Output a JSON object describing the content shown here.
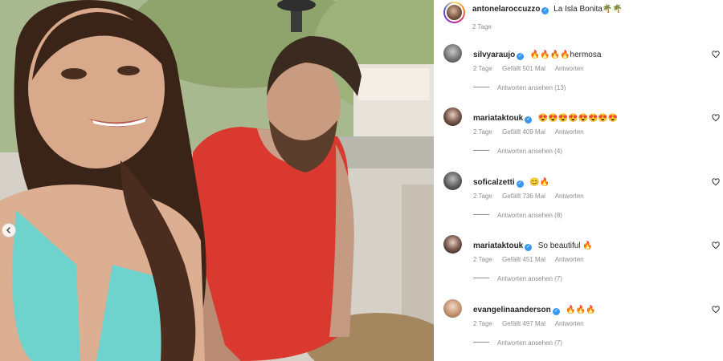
{
  "post": {
    "caption_user": "antonelaroccuzzo",
    "caption_text": "La Isla Bonita🌴🌴",
    "caption_time": "2 Tage"
  },
  "labels": {
    "reply": "Antworten",
    "verified_mark": "✓"
  },
  "comments": [
    {
      "user": "silvyaraujo",
      "text": "🔥🔥🔥🔥hermosa",
      "time": "2 Tage",
      "likes": "Gefällt 501 Mal",
      "view_replies": "Antworten ansehen (13)"
    },
    {
      "user": "mariataktouk",
      "text": "😍😍😍😍😍😍😍😍",
      "time": "2 Tage",
      "likes": "Gefällt 409 Mal",
      "view_replies": "Antworten ansehen (4)"
    },
    {
      "user": "soficalzetti",
      "text": "😊🔥",
      "time": "2 Tage",
      "likes": "Gefällt 736 Mal",
      "view_replies": "Antworten ansehen (8)"
    },
    {
      "user": "mariataktouk",
      "text": "So beautiful 🔥",
      "time": "2 Tage",
      "likes": "Gefällt 451 Mal",
      "view_replies": "Antworten ansehen (7)"
    },
    {
      "user": "evangelinaanderson",
      "text": "🔥🔥🔥",
      "time": "2 Tage",
      "likes": "Gefällt 497 Mal",
      "view_replies": "Antworten ansehen (7)"
    }
  ],
  "icons": {
    "prev": "chevron-left-icon",
    "like": "heart-icon",
    "verified": "verified-badge-icon"
  },
  "colors": {
    "verified": "#3897f0",
    "secondary_text": "#8e8e8e",
    "primary_text": "#262626"
  }
}
